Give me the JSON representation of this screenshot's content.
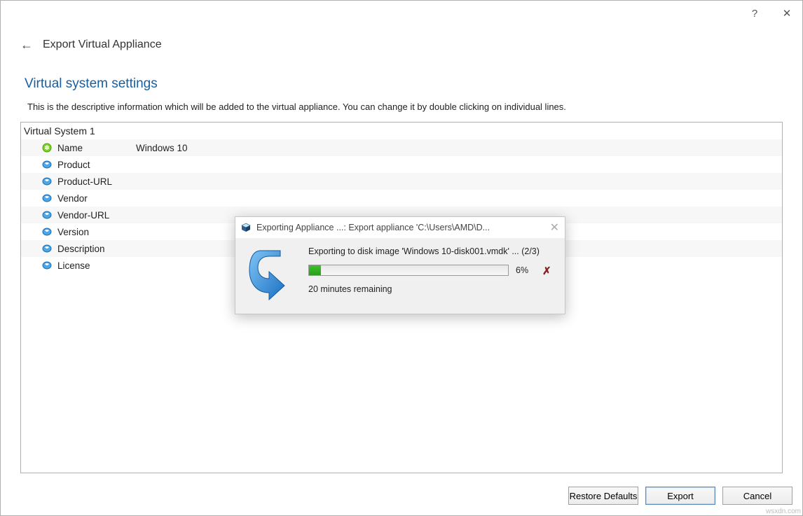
{
  "titlebar": {
    "help": "?",
    "close": "✕"
  },
  "header": {
    "back": "←",
    "title": "Export Virtual Appliance"
  },
  "section_title": "Virtual system settings",
  "description": "This is the descriptive information which will be added to the virtual appliance. You can change it by double clicking on individual lines.",
  "tree": {
    "root": "Virtual System 1",
    "rows": [
      {
        "label": "Name",
        "value": "Windows 10"
      },
      {
        "label": "Product",
        "value": ""
      },
      {
        "label": "Product-URL",
        "value": ""
      },
      {
        "label": "Vendor",
        "value": ""
      },
      {
        "label": "Vendor-URL",
        "value": ""
      },
      {
        "label": "Version",
        "value": ""
      },
      {
        "label": "Description",
        "value": ""
      },
      {
        "label": "License",
        "value": ""
      }
    ]
  },
  "buttons": {
    "restore": "Restore Defaults",
    "export": "Export",
    "cancel": "Cancel"
  },
  "dialog": {
    "title": "Exporting Appliance ...: Export appliance 'C:\\Users\\AMD\\D...",
    "status": "Exporting to disk image 'Windows 10-disk001.vmdk' ... (2/3)",
    "percent": "6%",
    "percent_num": 6,
    "remaining": "20 minutes remaining"
  },
  "watermark": "wsxdn.com"
}
